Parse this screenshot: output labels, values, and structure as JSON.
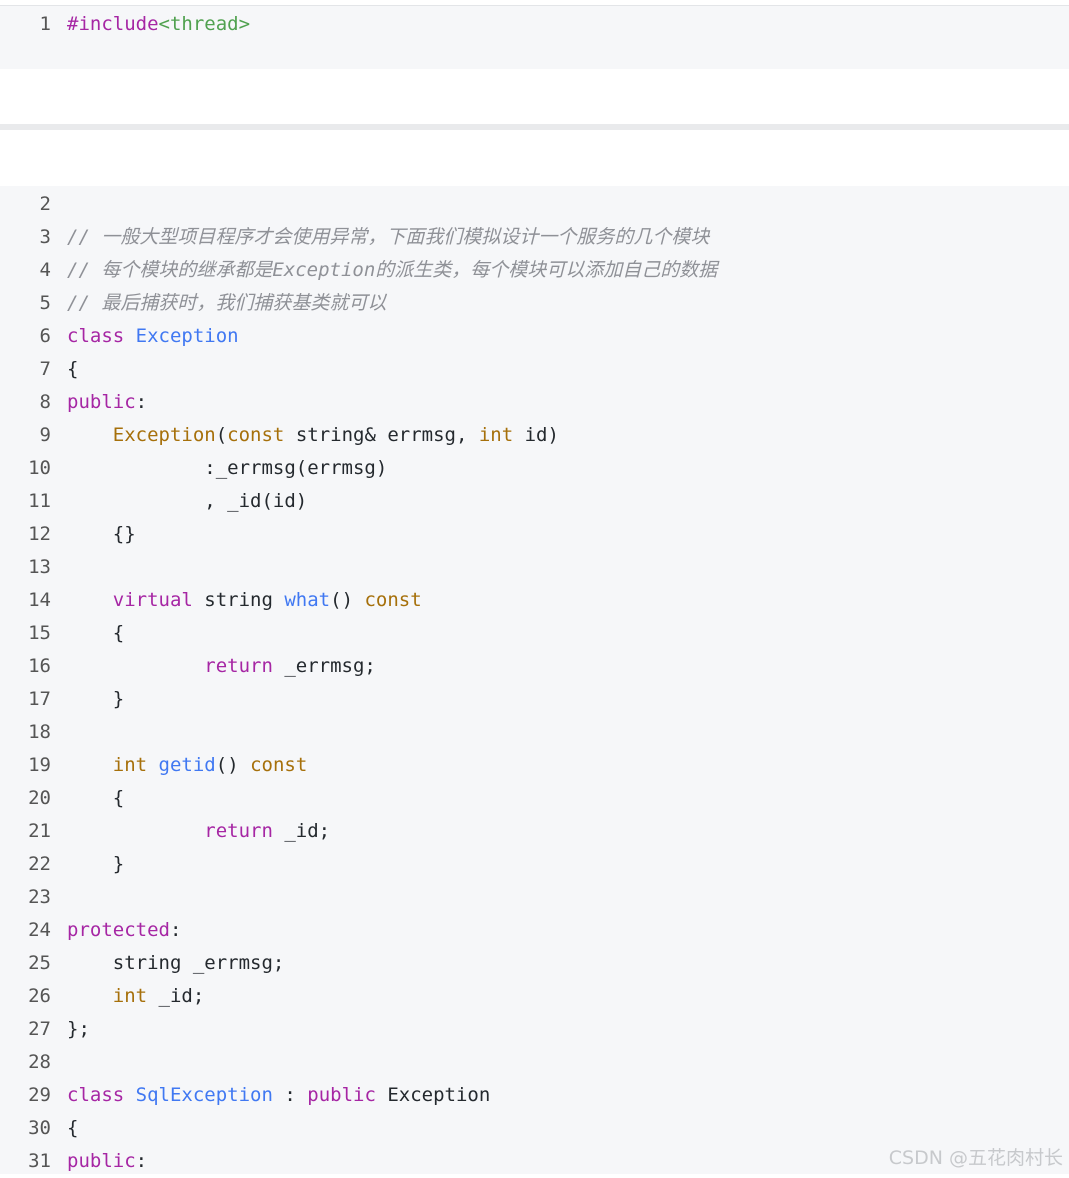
{
  "block1": {
    "lines": [
      {
        "n": "1",
        "tokens": [
          [
            "kw",
            "#include"
          ],
          [
            "str",
            "<thread>"
          ]
        ]
      }
    ]
  },
  "block2": {
    "lines": [
      {
        "n": "2",
        "tokens": []
      },
      {
        "n": "3",
        "tokens": [
          [
            "cm",
            "// 一般大型项目程序才会使用异常，下面我们模拟设计一个服务的几个模块"
          ]
        ]
      },
      {
        "n": "4",
        "tokens": [
          [
            "cm",
            "// 每个模块的继承都是Exception的派生类，每个模块可以添加自己的数据"
          ]
        ]
      },
      {
        "n": "5",
        "tokens": [
          [
            "cm",
            "// 最后捕获时，我们捕获基类就可以"
          ]
        ]
      },
      {
        "n": "6",
        "tokens": [
          [
            "kw",
            "class"
          ],
          [
            "p",
            " "
          ],
          [
            "fn",
            "Exception"
          ]
        ]
      },
      {
        "n": "7",
        "tokens": [
          [
            "p",
            "{"
          ]
        ]
      },
      {
        "n": "8",
        "tokens": [
          [
            "kw",
            "public"
          ],
          [
            "p",
            ":"
          ]
        ]
      },
      {
        "n": "9",
        "tokens": [
          [
            "p",
            "    "
          ],
          [
            "ty",
            "Exception"
          ],
          [
            "p",
            "("
          ],
          [
            "ty",
            "const"
          ],
          [
            "p",
            " string& errmsg, "
          ],
          [
            "ty",
            "int"
          ],
          [
            "p",
            " id)"
          ]
        ]
      },
      {
        "n": "10",
        "tokens": [
          [
            "p",
            "            :_errmsg(errmsg)"
          ]
        ]
      },
      {
        "n": "11",
        "tokens": [
          [
            "p",
            "            , _id(id)"
          ]
        ]
      },
      {
        "n": "12",
        "tokens": [
          [
            "p",
            "    {}"
          ]
        ]
      },
      {
        "n": "13",
        "tokens": []
      },
      {
        "n": "14",
        "tokens": [
          [
            "p",
            "    "
          ],
          [
            "kw",
            "virtual"
          ],
          [
            "p",
            " string "
          ],
          [
            "fn",
            "what"
          ],
          [
            "p",
            "() "
          ],
          [
            "ty",
            "const"
          ]
        ]
      },
      {
        "n": "15",
        "tokens": [
          [
            "p",
            "    {"
          ]
        ]
      },
      {
        "n": "16",
        "tokens": [
          [
            "p",
            "            "
          ],
          [
            "kw",
            "return"
          ],
          [
            "p",
            " _errmsg;"
          ]
        ]
      },
      {
        "n": "17",
        "tokens": [
          [
            "p",
            "    }"
          ]
        ]
      },
      {
        "n": "18",
        "tokens": []
      },
      {
        "n": "19",
        "tokens": [
          [
            "p",
            "    "
          ],
          [
            "ty",
            "int"
          ],
          [
            "p",
            " "
          ],
          [
            "fn",
            "getid"
          ],
          [
            "p",
            "() "
          ],
          [
            "ty",
            "const"
          ]
        ]
      },
      {
        "n": "20",
        "tokens": [
          [
            "p",
            "    {"
          ]
        ]
      },
      {
        "n": "21",
        "tokens": [
          [
            "p",
            "            "
          ],
          [
            "kw",
            "return"
          ],
          [
            "p",
            " _id;"
          ]
        ]
      },
      {
        "n": "22",
        "tokens": [
          [
            "p",
            "    }"
          ]
        ]
      },
      {
        "n": "23",
        "tokens": []
      },
      {
        "n": "24",
        "tokens": [
          [
            "kw",
            "protected"
          ],
          [
            "p",
            ":"
          ]
        ]
      },
      {
        "n": "25",
        "tokens": [
          [
            "p",
            "    string _errmsg;"
          ]
        ]
      },
      {
        "n": "26",
        "tokens": [
          [
            "p",
            "    "
          ],
          [
            "ty",
            "int"
          ],
          [
            "p",
            " _id;"
          ]
        ]
      },
      {
        "n": "27",
        "tokens": [
          [
            "p",
            "};"
          ]
        ]
      },
      {
        "n": "28",
        "tokens": []
      },
      {
        "n": "29",
        "tokens": [
          [
            "kw",
            "class"
          ],
          [
            "p",
            " "
          ],
          [
            "fn",
            "SqlException"
          ],
          [
            "p",
            " : "
          ],
          [
            "kw",
            "public"
          ],
          [
            "p",
            " Exception"
          ]
        ]
      },
      {
        "n": "30",
        "tokens": [
          [
            "p",
            "{"
          ]
        ]
      },
      {
        "n": "31",
        "tokens": [
          [
            "kw",
            "public"
          ],
          [
            "p",
            ":"
          ]
        ]
      }
    ]
  },
  "watermark": "CSDN @五花肉村长"
}
